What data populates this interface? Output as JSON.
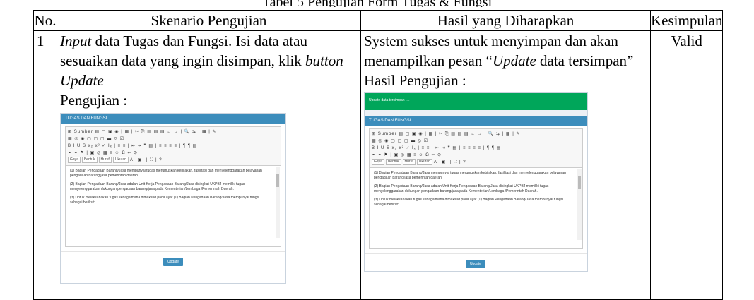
{
  "caption": "Tabel  5 Pengujian Form Tugas & Fungsi",
  "headers": [
    "No.",
    "Skenario Pengujian",
    "Hasil yang Diharapkan",
    "Kesimpulan"
  ],
  "row": {
    "no": "1",
    "scenario_pre": "Input",
    "scenario_mid": " data Tugas dan Fungsi. Isi data atau sesuaikan data yang ingin disimpan, klik ",
    "scenario_btn": "button Update",
    "scenario_label": "Pengujian :",
    "expected_pre": "System sukses untuk menyimpan dan akan menampilkan pesan “",
    "expected_italic": "Update",
    "expected_post": " data tersimpan”",
    "expected_label": "Hasil Pengujian :",
    "conclusion": "Valid"
  },
  "shot1": {
    "title": "TUGAS DAN FUNGSI",
    "toolbar": {
      "row1": "⊞ Sumber ▤ ▢ ▣ ◉ | ▦ | ✂ ⎘ ▤ ▤ ▤ ← → | 🔍 ⇆ | ▦ | ✎",
      "row2": "▦ ◎ ◉ ▢ ▢ ▢ ▬ ◎ ☑",
      "row3": "B I U S x₂ x² ✓ Iₓ | ≡ ≡ | ⇤ ⇥ ❞ ▤ | ≡ ≡ ≡ ≡ | ¶ ¶ ▤",
      "row4": "⚭ ⚭ ⚑ | ▣ ◎ ▦ ≡ ☺ Ω ⇐ ⊙",
      "styles": [
        "Gaya",
        "Bentuk",
        "Huruf",
        "Ukuran"
      ],
      "row5_tail": "A· ▣· | ⛶ | ?"
    },
    "paragraphs": [
      "(1) Bagian Pengadaan Barang/Jasa mempunyai tugas merumuskan kebijakan, fasilitasi dan menyelenggarakan pelayanan pengadaan barang/jasa pemerintah daerah",
      "(2) Bagian Pengadaan Barang/Jasa adalah Unit Kerja Pengadaan Barang/Jasa disingkat UKPBJ memiliki tugas menyelenggarakan dukungan pengadaan barang/jasa pada Kementerian/Lembaga /Pemerintah Daerah.",
      "(3) Untuk melaksanakan tugas sebagaimana dimaksud pada ayat (1) Bagian Pengadaan Barang/Jasa mempunyai fungsi sebagai berikut:"
    ],
    "button": "Update"
  },
  "shot2": {
    "alert": "Update data tersimpan ....",
    "title": "TUGAS DAN FUNGSI",
    "toolbar": {
      "row1": "⊞ Sumber ▤ ▢ ▣ ◉ | ▦ | ✂ ⎘ ▤ ▤ ▤ ← → | 🔍 ⇆ | ▦ | ✎",
      "row2": "▦ ◎ ◉ ▢ ▢ ▢ ▬ ◎ ☑",
      "row3": "B I U S x₂ x² ✓ Iₓ | ≡ ≡ | ⇤ ⇥ ❞ ▤ | ≡ ≡ ≡ ≡ | ¶ ¶ ▤",
      "row4": "⚭ ⚭ ⚑ | ▣ ◎ ▦ ≡ ☺ Ω ⇐ ⊙",
      "styles": [
        "Gaya",
        "Bentuk",
        "Huruf",
        "Ukuran"
      ],
      "row5_tail": "A· ▣· | ⛶ | ?"
    },
    "paragraphs": [
      "(1) Bagian Pengadaan Barang/Jasa mempunyai tugas merumuskan kebijakan, fasilitasi dan menyelenggarakan pelayanan pengadaan barang/jasa pemerintah daerah",
      "(2) Bagian Pengadaan Barang/Jasa adalah Unit Kerja Pengadaan Barang/Jasa disingkat UKPBJ memiliki tugas menyelenggarakan dukungan pengadaan barang/jasa pada Kementerian/Lembaga /Pemerintah Daerah.",
      "(3) Untuk melaksanakan tugas sebagaimana dimaksud pada ayat (1) Bagian Pengadaan Barang/Jasa mempunyai fungsi sebagai berikut:"
    ],
    "button": "Update"
  }
}
